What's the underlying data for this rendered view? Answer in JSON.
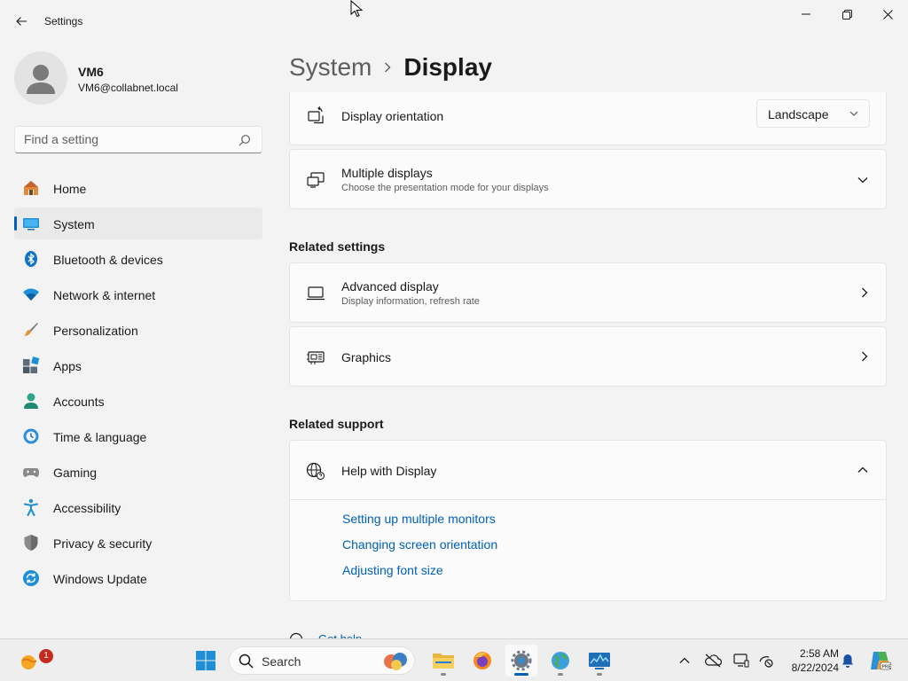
{
  "window": {
    "title": "Settings"
  },
  "profile": {
    "name": "VM6",
    "email": "VM6@collabnet.local"
  },
  "search": {
    "placeholder": "Find a setting"
  },
  "nav": [
    {
      "label": "Home",
      "icon": "home-icon"
    },
    {
      "label": "System",
      "icon": "system-icon",
      "active": true
    },
    {
      "label": "Bluetooth & devices",
      "icon": "bluetooth-icon"
    },
    {
      "label": "Network & internet",
      "icon": "wifi-icon"
    },
    {
      "label": "Personalization",
      "icon": "brush-icon"
    },
    {
      "label": "Apps",
      "icon": "apps-icon"
    },
    {
      "label": "Accounts",
      "icon": "accounts-icon"
    },
    {
      "label": "Time & language",
      "icon": "clock-globe-icon"
    },
    {
      "label": "Gaming",
      "icon": "gamepad-icon"
    },
    {
      "label": "Accessibility",
      "icon": "accessibility-icon"
    },
    {
      "label": "Privacy & security",
      "icon": "shield-icon"
    },
    {
      "label": "Windows Update",
      "icon": "update-icon"
    }
  ],
  "breadcrumb": {
    "parent": "System",
    "current": "Display"
  },
  "display_orientation": {
    "title": "Display orientation",
    "value": "Landscape"
  },
  "multiple_displays": {
    "title": "Multiple displays",
    "subtitle": "Choose the presentation mode for your displays"
  },
  "related_settings": {
    "heading": "Related settings",
    "advanced": {
      "title": "Advanced display",
      "subtitle": "Display information, refresh rate"
    },
    "graphics": {
      "title": "Graphics"
    }
  },
  "related_support": {
    "heading": "Related support",
    "help_title": "Help with Display",
    "links": [
      "Setting up multiple monitors",
      "Changing screen orientation",
      "Adjusting font size"
    ],
    "get_help": "Get help"
  },
  "taskbar": {
    "search_label": "Search",
    "time": "2:58 AM",
    "date": "8/22/2024",
    "notification_badge": "1"
  },
  "colors": {
    "accent": "#005fb8",
    "background": "#f3f3f3",
    "card": "#fbfbfb"
  }
}
